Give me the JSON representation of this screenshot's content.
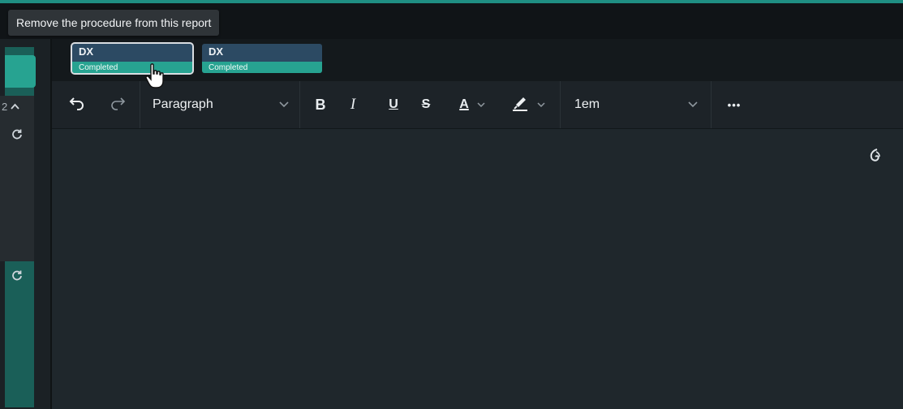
{
  "tooltip": {
    "text": "Remove the procedure from this report"
  },
  "left_rail": {
    "counter": "2"
  },
  "procedures": [
    {
      "code": "DX",
      "status": "Completed"
    },
    {
      "code": "DX",
      "status": "Completed"
    }
  ],
  "toolbar": {
    "block_format": "Paragraph",
    "bold": "B",
    "italic": "I",
    "underline": "U",
    "strikethrough": "S",
    "font_color": "A",
    "font_size": "1em",
    "more": "•••"
  },
  "colors": {
    "accent": "#27a391",
    "chip_bg": "#2c4a63",
    "editor_bg": "#1f272c",
    "toolbar_bg": "#1d2328"
  }
}
